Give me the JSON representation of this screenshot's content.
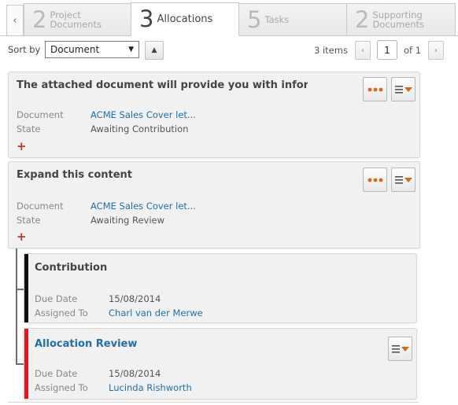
{
  "tabs": [
    {
      "number": "2",
      "label": "Project Documents"
    },
    {
      "number": "3",
      "label": "Allocations"
    },
    {
      "number": "5",
      "label": "Tasks"
    },
    {
      "number": "2",
      "label": "Supporting Documents"
    }
  ],
  "toolbar": {
    "sort_label": "Sort by",
    "sort_value": "Document",
    "items_count": "3 items",
    "page_current": "1",
    "page_of": "of 1"
  },
  "cards": [
    {
      "title": "The attached document will provide you with inform",
      "document_label": "Document",
      "document_value": "ACME Sales Cover let...",
      "state_label": "State",
      "state_value": "Awaiting Contribution"
    },
    {
      "title": "Expand this content",
      "document_label": "Document",
      "document_value": "ACME Sales Cover let...",
      "state_label": "State",
      "state_value": "Awaiting Review"
    }
  ],
  "subcards": [
    {
      "title": "Contribution",
      "due_label": "Due Date",
      "due_value": "15/08/2014",
      "assigned_label": "Assigned To",
      "assigned_value": "Charl van der Merwe",
      "stripe_color": "#111111"
    },
    {
      "title": "Allocation Review",
      "due_label": "Due Date",
      "due_value": "15/08/2014",
      "assigned_label": "Assigned To",
      "assigned_value": "Lucinda Rishworth",
      "stripe_color": "#e8141b"
    }
  ],
  "colors": {
    "accent_orange": "#d9661a",
    "link_blue": "#1f6fad",
    "add_red": "#c0392b"
  }
}
